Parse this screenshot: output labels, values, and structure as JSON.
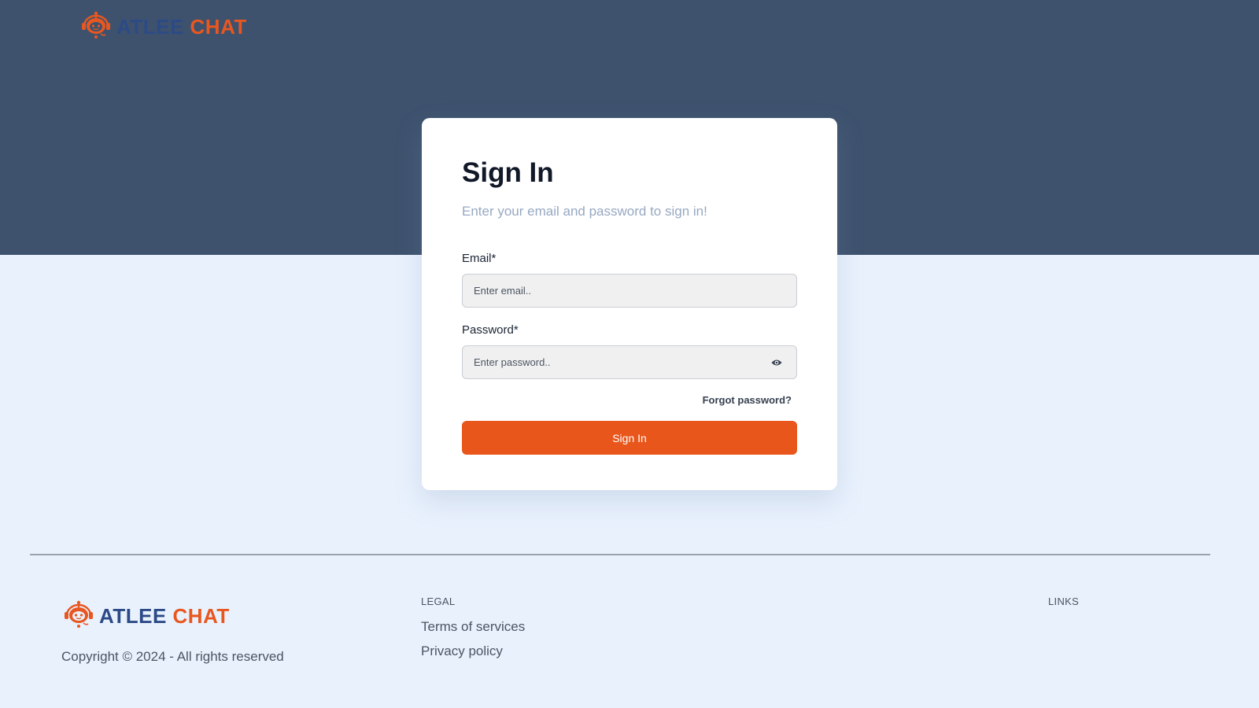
{
  "brand": {
    "word1": "ATLEE",
    "word2": "CHAT",
    "icon": "robot-icon",
    "colors": {
      "primary": "#2c4a86",
      "accent": "#e8571f"
    }
  },
  "signin": {
    "title": "Sign In",
    "subtitle": "Enter your email and password to sign in!",
    "email_label": "Email*",
    "email_placeholder": "Enter email..",
    "email_value": "",
    "password_label": "Password*",
    "password_placeholder": "Enter password..",
    "password_value": "",
    "show_password_icon": "eye-icon",
    "forgot_label": "Forgot password?",
    "submit_label": "Sign In"
  },
  "footer": {
    "copyright": "Copyright © 2024 - All rights reserved",
    "legal_title": "LEGAL",
    "legal_links": [
      "Terms of services",
      "Privacy policy"
    ],
    "links_title": "LINKS"
  },
  "colors": {
    "header_band": "#3e526e",
    "page_background": "#e9f1fd",
    "button": "#e8561b"
  }
}
